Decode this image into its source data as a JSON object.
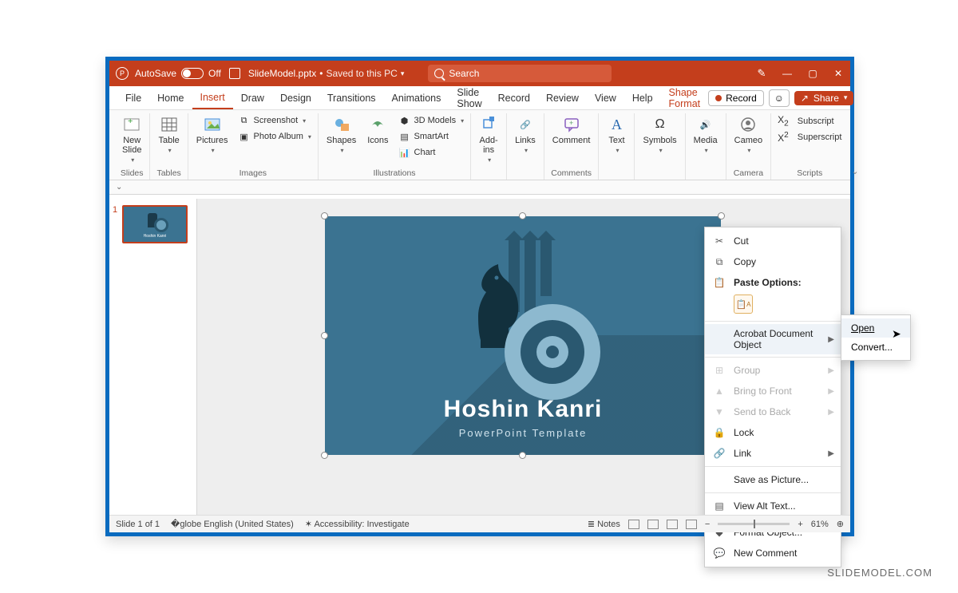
{
  "titlebar": {
    "autosave_label": "AutoSave",
    "autosave_state": "Off",
    "filename": "SlideModel.pptx",
    "saved_status": "Saved to this PC",
    "search_placeholder": "Search"
  },
  "tabs": {
    "file": "File",
    "home": "Home",
    "insert": "Insert",
    "draw": "Draw",
    "design": "Design",
    "transitions": "Transitions",
    "animations": "Animations",
    "slideshow": "Slide Show",
    "record": "Record",
    "review": "Review",
    "view": "View",
    "help": "Help",
    "shapeformat": "Shape Format",
    "record_btn": "Record",
    "share_btn": "Share"
  },
  "ribbon": {
    "new_slide": "New\nSlide",
    "slides_group": "Slides",
    "table": "Table",
    "tables_group": "Tables",
    "pictures": "Pictures",
    "screenshot": "Screenshot",
    "photo_album": "Photo Album",
    "images_group": "Images",
    "shapes": "Shapes",
    "icons": "Icons",
    "models3d": "3D Models",
    "smartart": "SmartArt",
    "chart": "Chart",
    "illustrations_group": "Illustrations",
    "addins": "Add-\nins",
    "links": "Links",
    "comment": "Comment",
    "comments_group": "Comments",
    "text": "Text",
    "symbols": "Symbols",
    "media": "Media",
    "cameo": "Cameo",
    "camera_group": "Camera",
    "subscript": "Subscript",
    "superscript": "Superscript",
    "scripts_group": "Scripts"
  },
  "thumbnail": {
    "number": "1"
  },
  "slide": {
    "title": "Hoshin Kanri",
    "subtitle": "PowerPoint Template"
  },
  "context_menu": {
    "cut": "Cut",
    "copy": "Copy",
    "paste_options": "Paste Options:",
    "acrobat_object": "Acrobat Document Object",
    "group": "Group",
    "bring_front": "Bring to Front",
    "send_back": "Send to Back",
    "lock": "Lock",
    "link": "Link",
    "save_picture": "Save as Picture...",
    "alt_text": "View Alt Text...",
    "format_object": "Format Object...",
    "new_comment": "New Comment"
  },
  "submenu": {
    "open": "Open",
    "convert": "Convert..."
  },
  "statusbar": {
    "slide_count": "Slide 1 of 1",
    "language": "English (United States)",
    "accessibility": "Accessibility: Investigate",
    "notes": "Notes",
    "zoom": "61%"
  },
  "watermark": "SLIDEMODEL.COM"
}
